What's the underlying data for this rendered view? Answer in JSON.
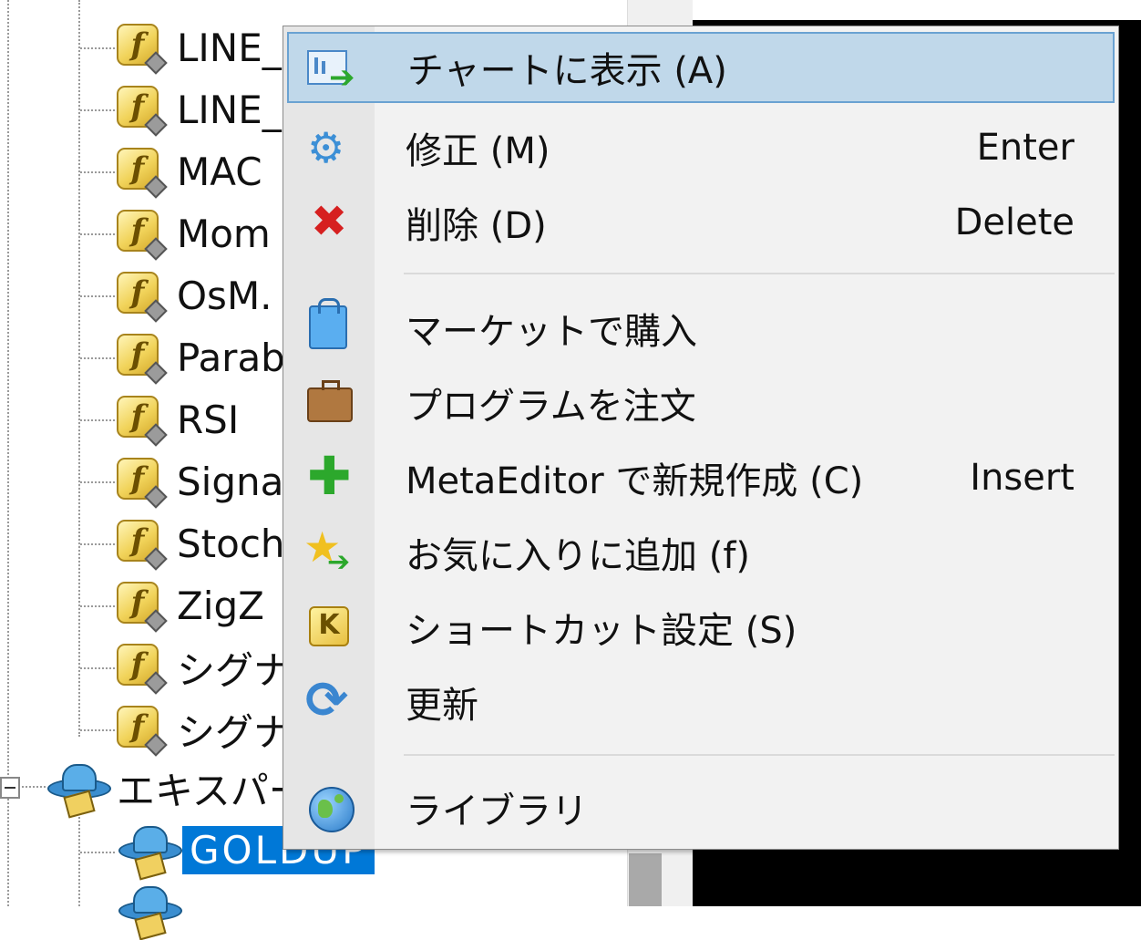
{
  "navigator": {
    "indicators": [
      {
        "label": "LINE_"
      },
      {
        "label": "LINE_"
      },
      {
        "label": "MAC"
      },
      {
        "label": "Mom"
      },
      {
        "label": "OsM."
      },
      {
        "label": "Parab"
      },
      {
        "label": "RSI"
      },
      {
        "label": "Signa"
      },
      {
        "label": "Stoch"
      },
      {
        "label": "ZigZ"
      },
      {
        "label": "シグナ"
      },
      {
        "label": "シグナ"
      }
    ],
    "expert_folder": {
      "label": "エキスパー"
    },
    "selected_item": {
      "label": "GOLDUP"
    }
  },
  "context_menu": {
    "items": [
      {
        "label": "チャートに表示 (A)",
        "shortcut": "",
        "icon": "show-on-chart-icon",
        "highlighted": true
      },
      {
        "label": "修正 (M)",
        "shortcut": "Enter",
        "icon": "gear-icon"
      },
      {
        "label": "削除 (D)",
        "shortcut": "Delete",
        "icon": "delete-x-icon"
      },
      {
        "label": "マーケットで購入",
        "shortcut": "",
        "icon": "market-bag-icon"
      },
      {
        "label": "プログラムを注文",
        "shortcut": "",
        "icon": "briefcase-icon"
      },
      {
        "label": "MetaEditor で新規作成 (C)",
        "shortcut": "Insert",
        "icon": "plus-icon"
      },
      {
        "label": "お気に入りに追加 (f)",
        "shortcut": "",
        "icon": "star-arrow-icon"
      },
      {
        "label": "ショートカット設定 (S)",
        "shortcut": "",
        "icon": "hotkey-k-icon"
      },
      {
        "label": "更新",
        "shortcut": "",
        "icon": "refresh-icon"
      },
      {
        "label": "ライブラリ",
        "shortcut": "",
        "icon": "globe-icon"
      }
    ],
    "hotkey_icon_letter": "K",
    "highlight_color": "#c0d8ea",
    "selection_color": "#0078d7"
  }
}
